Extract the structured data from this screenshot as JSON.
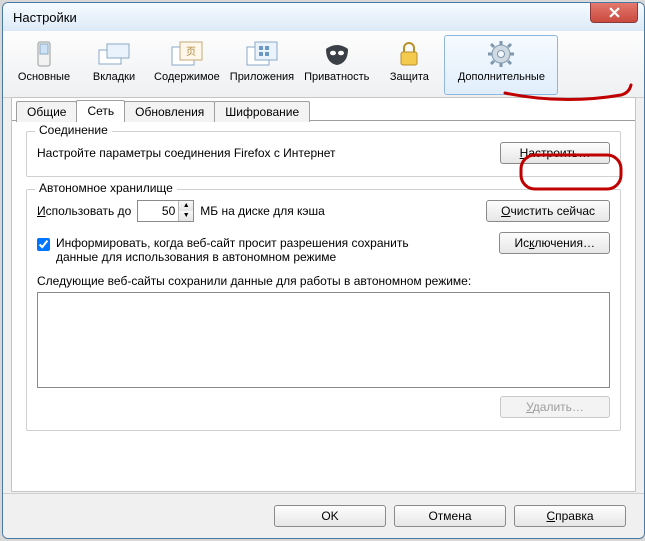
{
  "window": {
    "title": "Настройки"
  },
  "toolbar": {
    "items": [
      {
        "label": "Основные"
      },
      {
        "label": "Вкладки"
      },
      {
        "label": "Содержимое"
      },
      {
        "label": "Приложения"
      },
      {
        "label": "Приватность"
      },
      {
        "label": "Защита"
      },
      {
        "label": "Дополнительные"
      }
    ]
  },
  "subtabs": {
    "items": [
      {
        "label": "Общие"
      },
      {
        "label": "Сеть"
      },
      {
        "label": "Обновления"
      },
      {
        "label": "Шифрование"
      }
    ]
  },
  "connection": {
    "legend": "Соединение",
    "desc": "Настройте параметры соединения Firefox с Интернет",
    "button": "Настроить…"
  },
  "storage": {
    "legend": "Автономное хранилище",
    "use_prefix": "Использовать до",
    "cache_value": "50",
    "use_suffix": "МБ на диске для кэша",
    "clear_button": "Очистить сейчас",
    "inform_label": "Информировать, когда веб-сайт просит разрешения сохранить данные для использования в автономном режиме",
    "exceptions_button": "Исключения…",
    "list_heading": "Следующие веб-сайты сохранили данные для работы в автономном режиме:",
    "delete_button": "Удалить…"
  },
  "footer": {
    "ok": "OK",
    "cancel": "Отмена",
    "help": "Справка"
  }
}
